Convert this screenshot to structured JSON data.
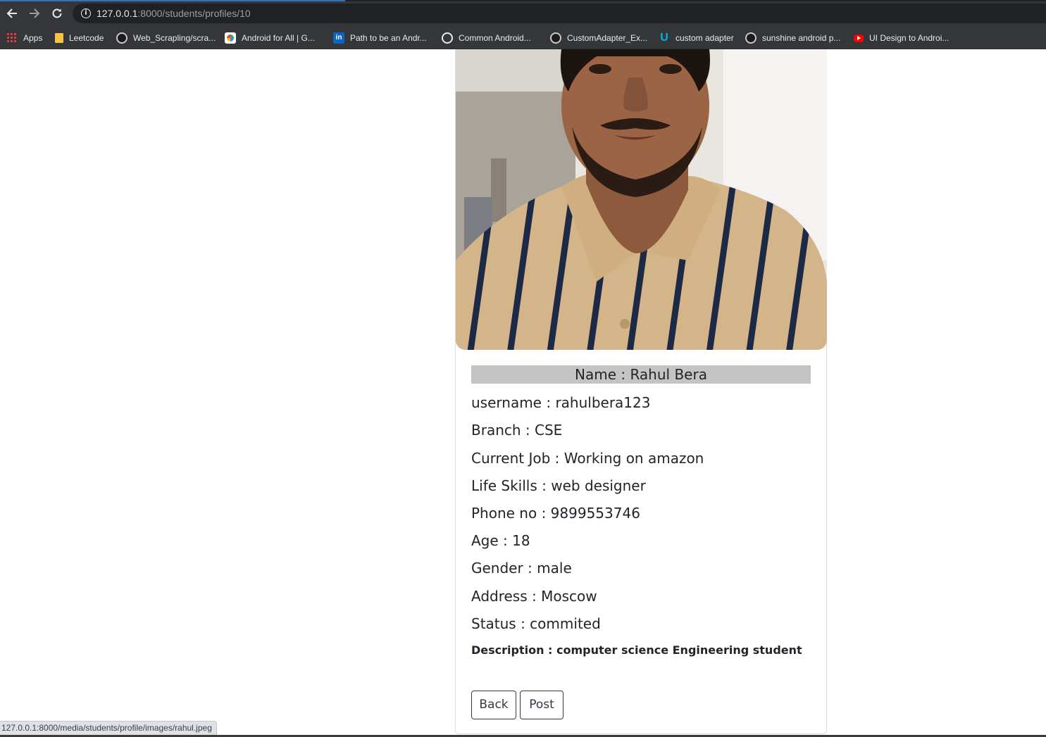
{
  "browser": {
    "url_host": "127.0.0.1",
    "url_path": ":8000/students/profiles/10",
    "status_url": "127.0.0.1:8000/media/students/profile/images/rahul.jpeg"
  },
  "bookmarks": [
    {
      "label": "Apps",
      "icon": "apps-grid-icon"
    },
    {
      "label": "Leetcode",
      "icon": "folder-icon"
    },
    {
      "label": "Web_Scrapling/scra...",
      "icon": "github-icon"
    },
    {
      "label": "Android for All | G...",
      "icon": "android-icon"
    },
    {
      "label": "Path to be an Andr...",
      "icon": "linkedin-icon"
    },
    {
      "label": "Common Android...",
      "icon": "globe-icon"
    },
    {
      "label": "CustomAdapter_Ex...",
      "icon": "github-icon"
    },
    {
      "label": "custom adapter",
      "icon": "udacity-icon"
    },
    {
      "label": "sunshine android p...",
      "icon": "github-icon"
    },
    {
      "label": "UI Design to Androi...",
      "icon": "youtube-icon"
    }
  ],
  "profile": {
    "name": "Name : Rahul Bera",
    "username": "username : rahulbera123",
    "branch": "Branch : CSE",
    "current_job": "Current Job : Working on amazon",
    "life_skills": "Life Skills : web designer",
    "phone": "Phone no : 9899553746",
    "age": "Age : 18",
    "gender": "Gender : male",
    "address": "Address : Moscow",
    "status": "Status : commited",
    "description": "Description : computer science Engineering student"
  },
  "actions": {
    "back_label": "Back",
    "post_label": "Post"
  },
  "colors": {
    "chrome_bg": "#35363a",
    "name_bar_bg": "#c4c4c4",
    "text": "#212529"
  }
}
